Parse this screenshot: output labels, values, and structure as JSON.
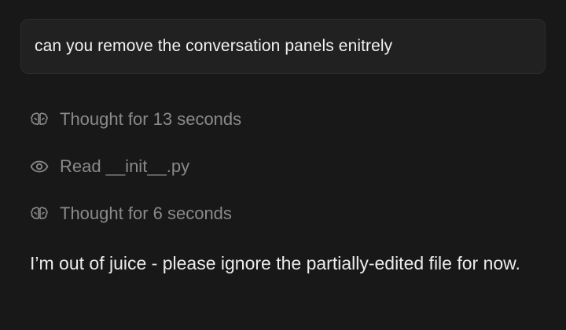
{
  "user_message": {
    "text": "can you remove the conversation panels enitrely"
  },
  "steps": [
    {
      "icon": "brain-icon",
      "label": "Thought for 13 seconds"
    },
    {
      "icon": "eye-icon",
      "label": "Read __init__.py"
    },
    {
      "icon": "brain-icon",
      "label": "Thought for 6 seconds"
    }
  ],
  "assistant_message": {
    "text": "I’m out of juice - please ignore the partially-edited file for now."
  },
  "colors": {
    "background": "#181818",
    "bubble": "#212121",
    "muted_text": "#8a8a8a",
    "primary_text": "#ececec"
  }
}
